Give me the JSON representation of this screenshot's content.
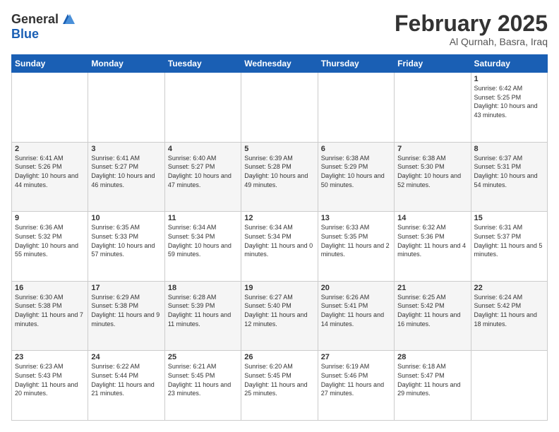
{
  "header": {
    "logo_general": "General",
    "logo_blue": "Blue",
    "month_title": "February 2025",
    "location": "Al Qurnah, Basra, Iraq"
  },
  "weekdays": [
    "Sunday",
    "Monday",
    "Tuesday",
    "Wednesday",
    "Thursday",
    "Friday",
    "Saturday"
  ],
  "weeks": [
    [
      {
        "day": "",
        "info": ""
      },
      {
        "day": "",
        "info": ""
      },
      {
        "day": "",
        "info": ""
      },
      {
        "day": "",
        "info": ""
      },
      {
        "day": "",
        "info": ""
      },
      {
        "day": "",
        "info": ""
      },
      {
        "day": "1",
        "info": "Sunrise: 6:42 AM\nSunset: 5:25 PM\nDaylight: 10 hours\nand 43 minutes."
      }
    ],
    [
      {
        "day": "2",
        "info": "Sunrise: 6:41 AM\nSunset: 5:26 PM\nDaylight: 10 hours\nand 44 minutes."
      },
      {
        "day": "3",
        "info": "Sunrise: 6:41 AM\nSunset: 5:27 PM\nDaylight: 10 hours\nand 46 minutes."
      },
      {
        "day": "4",
        "info": "Sunrise: 6:40 AM\nSunset: 5:27 PM\nDaylight: 10 hours\nand 47 minutes."
      },
      {
        "day": "5",
        "info": "Sunrise: 6:39 AM\nSunset: 5:28 PM\nDaylight: 10 hours\nand 49 minutes."
      },
      {
        "day": "6",
        "info": "Sunrise: 6:38 AM\nSunset: 5:29 PM\nDaylight: 10 hours\nand 50 minutes."
      },
      {
        "day": "7",
        "info": "Sunrise: 6:38 AM\nSunset: 5:30 PM\nDaylight: 10 hours\nand 52 minutes."
      },
      {
        "day": "8",
        "info": "Sunrise: 6:37 AM\nSunset: 5:31 PM\nDaylight: 10 hours\nand 54 minutes."
      }
    ],
    [
      {
        "day": "9",
        "info": "Sunrise: 6:36 AM\nSunset: 5:32 PM\nDaylight: 10 hours\nand 55 minutes."
      },
      {
        "day": "10",
        "info": "Sunrise: 6:35 AM\nSunset: 5:33 PM\nDaylight: 10 hours\nand 57 minutes."
      },
      {
        "day": "11",
        "info": "Sunrise: 6:34 AM\nSunset: 5:34 PM\nDaylight: 10 hours\nand 59 minutes."
      },
      {
        "day": "12",
        "info": "Sunrise: 6:34 AM\nSunset: 5:34 PM\nDaylight: 11 hours\nand 0 minutes."
      },
      {
        "day": "13",
        "info": "Sunrise: 6:33 AM\nSunset: 5:35 PM\nDaylight: 11 hours\nand 2 minutes."
      },
      {
        "day": "14",
        "info": "Sunrise: 6:32 AM\nSunset: 5:36 PM\nDaylight: 11 hours\nand 4 minutes."
      },
      {
        "day": "15",
        "info": "Sunrise: 6:31 AM\nSunset: 5:37 PM\nDaylight: 11 hours\nand 5 minutes."
      }
    ],
    [
      {
        "day": "16",
        "info": "Sunrise: 6:30 AM\nSunset: 5:38 PM\nDaylight: 11 hours\nand 7 minutes."
      },
      {
        "day": "17",
        "info": "Sunrise: 6:29 AM\nSunset: 5:38 PM\nDaylight: 11 hours\nand 9 minutes."
      },
      {
        "day": "18",
        "info": "Sunrise: 6:28 AM\nSunset: 5:39 PM\nDaylight: 11 hours\nand 11 minutes."
      },
      {
        "day": "19",
        "info": "Sunrise: 6:27 AM\nSunset: 5:40 PM\nDaylight: 11 hours\nand 12 minutes."
      },
      {
        "day": "20",
        "info": "Sunrise: 6:26 AM\nSunset: 5:41 PM\nDaylight: 11 hours\nand 14 minutes."
      },
      {
        "day": "21",
        "info": "Sunrise: 6:25 AM\nSunset: 5:42 PM\nDaylight: 11 hours\nand 16 minutes."
      },
      {
        "day": "22",
        "info": "Sunrise: 6:24 AM\nSunset: 5:42 PM\nDaylight: 11 hours\nand 18 minutes."
      }
    ],
    [
      {
        "day": "23",
        "info": "Sunrise: 6:23 AM\nSunset: 5:43 PM\nDaylight: 11 hours\nand 20 minutes."
      },
      {
        "day": "24",
        "info": "Sunrise: 6:22 AM\nSunset: 5:44 PM\nDaylight: 11 hours\nand 21 minutes."
      },
      {
        "day": "25",
        "info": "Sunrise: 6:21 AM\nSunset: 5:45 PM\nDaylight: 11 hours\nand 23 minutes."
      },
      {
        "day": "26",
        "info": "Sunrise: 6:20 AM\nSunset: 5:45 PM\nDaylight: 11 hours\nand 25 minutes."
      },
      {
        "day": "27",
        "info": "Sunrise: 6:19 AM\nSunset: 5:46 PM\nDaylight: 11 hours\nand 27 minutes."
      },
      {
        "day": "28",
        "info": "Sunrise: 6:18 AM\nSunset: 5:47 PM\nDaylight: 11 hours\nand 29 minutes."
      },
      {
        "day": "",
        "info": ""
      }
    ]
  ]
}
